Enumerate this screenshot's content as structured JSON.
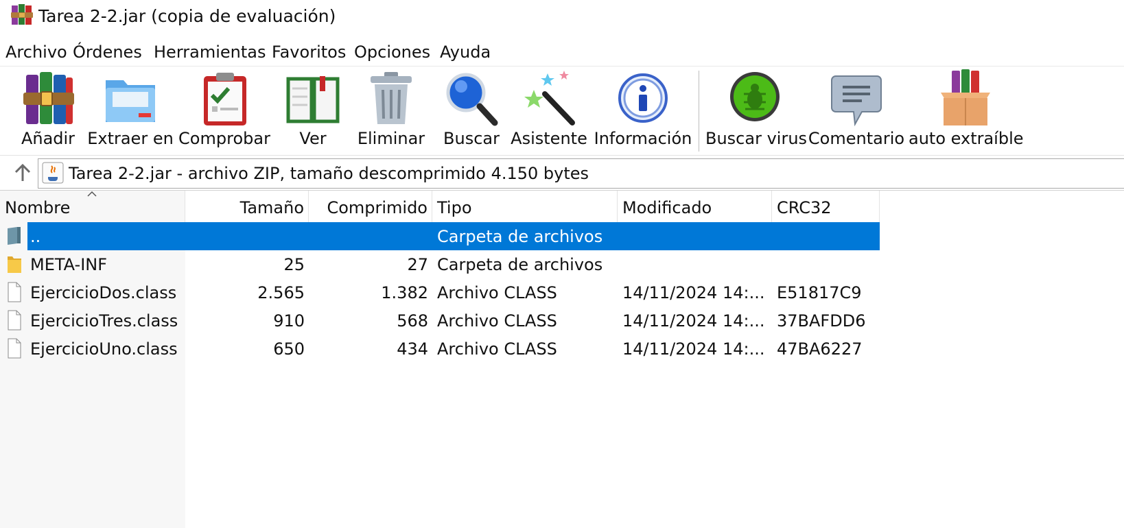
{
  "window": {
    "title": "Tarea 2-2.jar (copia de evaluación)",
    "app_icon": "winrar-books-icon"
  },
  "menu": [
    "Archivo",
    "Órdenes",
    "Herramientas",
    "Favoritos",
    "Opciones",
    "Ayuda"
  ],
  "toolbar": {
    "buttons": [
      {
        "label": "Añadir",
        "icon": "add-archive-icon"
      },
      {
        "label": "Extraer en",
        "icon": "extract-folder-icon"
      },
      {
        "label": "Comprobar",
        "icon": "test-clipboard-icon"
      },
      {
        "label": "Ver",
        "icon": "view-book-icon"
      },
      {
        "label": "Eliminar",
        "icon": "trash-icon"
      },
      {
        "label": "Buscar",
        "icon": "magnifier-icon"
      },
      {
        "label": "Asistente",
        "icon": "wizard-wand-icon"
      },
      {
        "label": "Información",
        "icon": "info-icon"
      },
      {
        "label": "Buscar virus",
        "icon": "virus-scan-icon"
      },
      {
        "label": "Comentario",
        "icon": "comment-icon"
      },
      {
        "label": "auto extraíble",
        "icon": "sfx-box-icon"
      }
    ]
  },
  "address": {
    "text": "Tarea 2-2.jar - archivo ZIP, tamaño descomprimido 4.150 bytes",
    "icon": "java-file-icon"
  },
  "columns": {
    "name": "Nombre",
    "size": "Tamaño",
    "packed": "Comprimido",
    "type": "Tipo",
    "modified": "Modificado",
    "crc": "CRC32"
  },
  "rows": [
    {
      "name": "..",
      "size": "",
      "packed": "",
      "type": "Carpeta de archivos",
      "modified": "",
      "crc": "",
      "icon": "parent-folder-icon",
      "selected": true
    },
    {
      "name": "META-INF",
      "size": "25",
      "packed": "27",
      "type": "Carpeta de archivos",
      "modified": "",
      "crc": "",
      "icon": "folder-icon",
      "selected": false
    },
    {
      "name": "EjercicioDos.class",
      "size": "2.565",
      "packed": "1.382",
      "type": "Archivo CLASS",
      "modified": "14/11/2024 14:...",
      "crc": "E51817C9",
      "icon": "file-icon",
      "selected": false
    },
    {
      "name": "EjercicioTres.class",
      "size": "910",
      "packed": "568",
      "type": "Archivo CLASS",
      "modified": "14/11/2024 14:...",
      "crc": "37BAFDD6",
      "icon": "file-icon",
      "selected": false
    },
    {
      "name": "EjercicioUno.class",
      "size": "650",
      "packed": "434",
      "type": "Archivo CLASS",
      "modified": "14/11/2024 14:...",
      "crc": "47BA6227",
      "icon": "file-icon",
      "selected": false
    }
  ],
  "colors": {
    "selection": "#0078d7",
    "folder": "#f7c948",
    "parent_folder": "#6e96a8"
  }
}
